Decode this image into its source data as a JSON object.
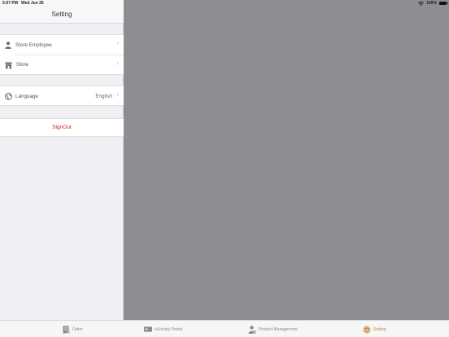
{
  "status": {
    "time": "5:07 PM",
    "date": "Wed Jun 26",
    "battery": "100%"
  },
  "nav": {
    "title": "Setting"
  },
  "settings": {
    "store_employee": "Store Employee",
    "store": "Store",
    "language_label": "Language",
    "language_value": "English",
    "signout": "SignOut"
  },
  "tabs": [
    {
      "label": "Order",
      "icon": "order-icon"
    },
    {
      "label": "eSociety Points",
      "icon": "points-icon"
    },
    {
      "label": "Product Management",
      "icon": "product-icon"
    },
    {
      "label": "Setting",
      "icon": "gear-icon",
      "active": true
    }
  ],
  "colors": {
    "accent": "#c58a33",
    "signout": "#c9242b",
    "detail_bg": "#8e8d91"
  }
}
